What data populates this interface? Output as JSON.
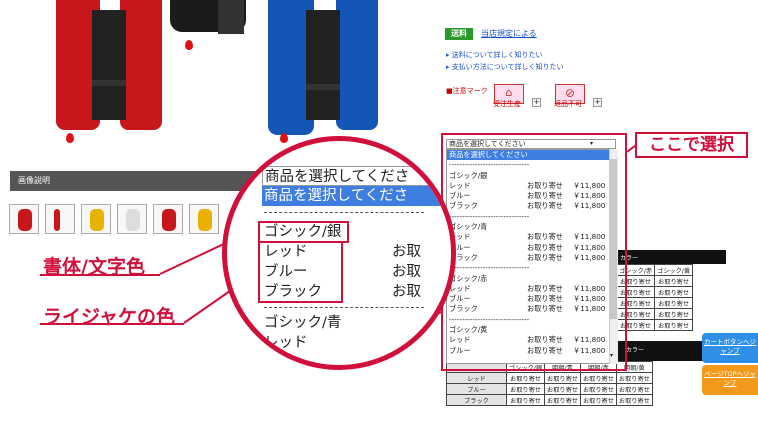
{
  "caption": {
    "label": "画像説明"
  },
  "shipping": {
    "badge": "送料",
    "link": "当店規定による"
  },
  "info_links": [
    "送料について詳しく知りたい",
    "支払い方法について詳しく知りたい"
  ],
  "caution": {
    "label": "注意マーク",
    "icons": [
      {
        "name": "order-production-icon",
        "text": "受注生産"
      },
      {
        "name": "no-return-icon",
        "text": "返品不可"
      }
    ]
  },
  "dropdown": {
    "placeholder": "商品を選択してください",
    "highlighted": "商品を選択してください",
    "separator": "-------------------------------",
    "groups": [
      {
        "title": "ゴシック/銀",
        "rows": [
          {
            "color": "レッド",
            "status": "お取り寄せ",
            "price": "￥11,800"
          },
          {
            "color": "ブルー",
            "status": "お取り寄せ",
            "price": "￥11,800"
          },
          {
            "color": "ブラック",
            "status": "お取り寄せ",
            "price": "￥11,800"
          }
        ]
      },
      {
        "title": "ゴシック/青",
        "rows": [
          {
            "color": "レッド",
            "status": "お取り寄せ",
            "price": "￥11,800"
          },
          {
            "color": "ブルー",
            "status": "お取り寄せ",
            "price": "￥11,800"
          },
          {
            "color": "ブラック",
            "status": "お取り寄せ",
            "price": "￥11,800"
          }
        ]
      },
      {
        "title": "ゴシック/赤",
        "rows": [
          {
            "color": "レッド",
            "status": "お取り寄せ",
            "price": "￥11,800"
          },
          {
            "color": "ブルー",
            "status": "お取り寄せ",
            "price": "￥11,800"
          },
          {
            "color": "ブラック",
            "status": "お取り寄せ",
            "price": "￥11,800"
          }
        ]
      },
      {
        "title": "ゴシック/黄",
        "rows": [
          {
            "color": "レッド",
            "status": "お取り寄せ",
            "price": "￥11,800"
          },
          {
            "color": "ブルー",
            "status": "お取り寄せ",
            "price": "￥11,800"
          }
        ]
      }
    ]
  },
  "magnifier": {
    "select": "商品を選択してくださ",
    "highlighted": "商品を選択してくださ",
    "separator": "----------------------",
    "group1": "ゴシック/銀",
    "rows": [
      {
        "color": "レッド",
        "status": "お取"
      },
      {
        "color": "ブルー",
        "status": "お取"
      },
      {
        "color": "ブラック",
        "status": "お取"
      }
    ],
    "group2": "ゴシック/青",
    "next_row": "レッド"
  },
  "callouts": {
    "choose_here": "ここで選択",
    "font_color": "書体/文字色",
    "vest_color": "ライジャケの色"
  },
  "color_table": {
    "header1": "カラー",
    "cols1": [
      "ゴシック/赤",
      "ゴシック/黄"
    ],
    "header2": "カラー",
    "cols2": [
      "ゴシック/銀",
      "明朝/青",
      "明朝/赤",
      "明朝/黄"
    ],
    "cell": "お取り寄せ",
    "row_labels": [
      "レッド",
      "ブルー",
      "ブラック"
    ]
  },
  "side_buttons": {
    "cart": "カートボタンへジャンプ",
    "top": "ページTOPへジャンプ"
  }
}
